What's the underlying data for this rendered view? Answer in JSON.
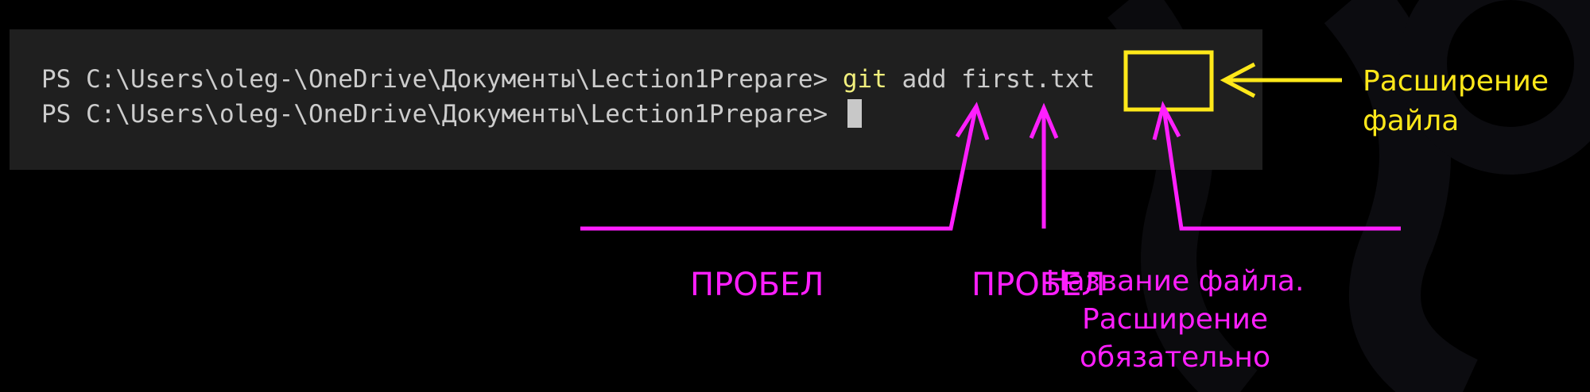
{
  "colors": {
    "background": "#000000",
    "terminal_bg": "#1f1f1f",
    "terminal_text": "#cccccc",
    "command_highlight": "#f1ef7d",
    "annotation_magenta": "#ff1fff",
    "annotation_yellow": "#ffe81a"
  },
  "terminal": {
    "line1": {
      "prompt": "PS C:\\Users\\oleg-\\OneDrive\\Документы\\Lection1Prepare> ",
      "cmd_git": "git",
      "cmd_rest": " add first.txt"
    },
    "line2": {
      "prompt": "PS C:\\Users\\oleg-\\OneDrive\\Документы\\Lection1Prepare> "
    }
  },
  "annotations": {
    "space_label_1": "ПРОБЕЛ",
    "space_label_2": "ПРОБЕЛ",
    "file_name": {
      "line1": "Название файла.",
      "line2": "Расширение",
      "line3": "обязательно"
    },
    "extension": {
      "line1": "Расширение",
      "line2": "файла"
    }
  },
  "icons": [
    "cursor-block",
    "arrow-up-icon",
    "arrow-left-icon",
    "highlight-box"
  ]
}
